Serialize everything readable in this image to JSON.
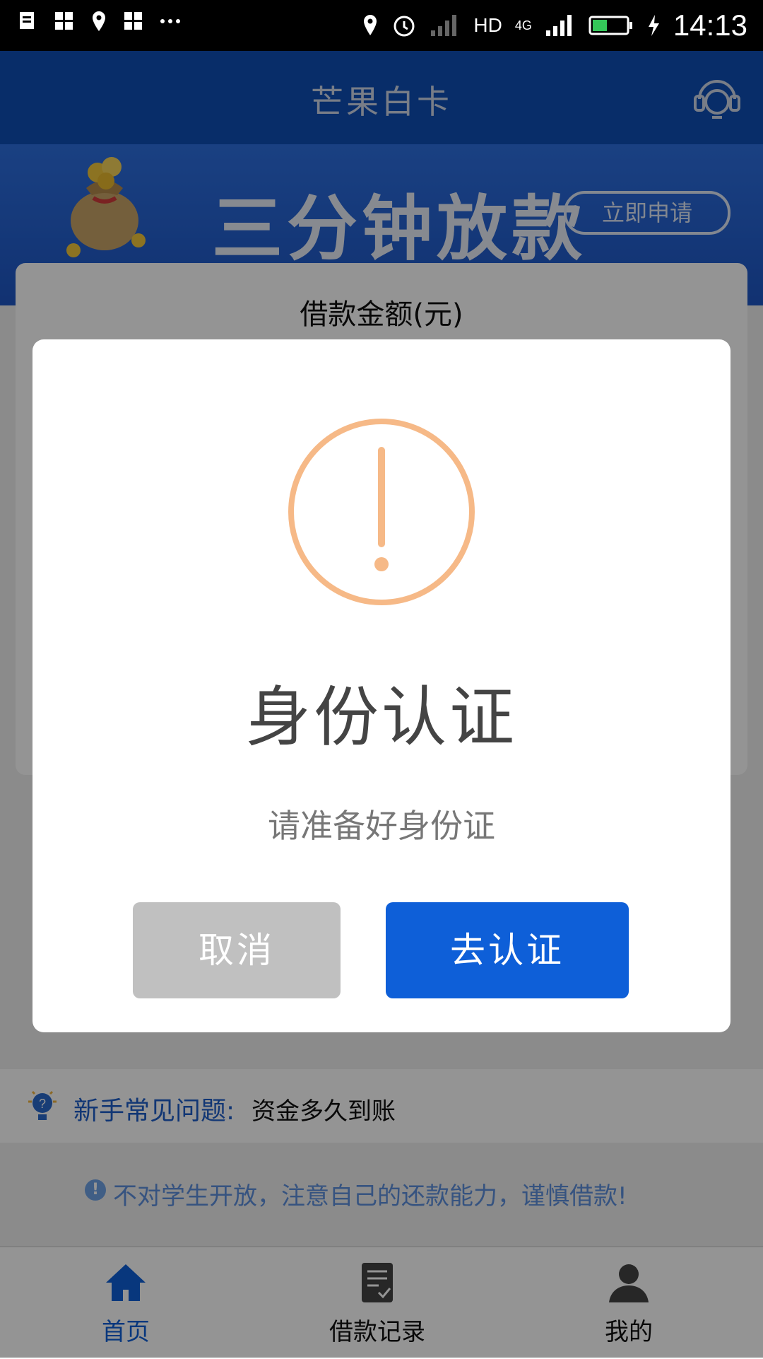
{
  "status_bar": {
    "network": "HD",
    "network_type": "4G",
    "time": "14:13"
  },
  "header": {
    "title": "芒果白卡",
    "support_icon": "headset-icon"
  },
  "banner": {
    "headline": "三分钟放款",
    "cta": "立即申请"
  },
  "card": {
    "title": "借款金额(元)"
  },
  "faq": {
    "label": "新手常见问题:",
    "answer": "资金多久到账"
  },
  "warning": {
    "text": "不对学生开放，注意自己的还款能力，谨慎借款!"
  },
  "bottom_nav": {
    "items": [
      {
        "label": "首页",
        "icon": "home-icon",
        "active": true
      },
      {
        "label": "借款记录",
        "icon": "document-check-icon",
        "active": false
      },
      {
        "label": "我的",
        "icon": "user-icon",
        "active": false
      }
    ]
  },
  "dialog": {
    "icon": "exclamation-circle-icon",
    "title": "身份认证",
    "message": "请准备好身份证",
    "cancel_label": "取消",
    "confirm_label": "去认证"
  },
  "colors": {
    "brand_blue": "#0f4fb6",
    "confirm_blue": "#0e5fd8",
    "warning_orange": "#f6b987",
    "cancel_gray": "#c0c0c0"
  }
}
